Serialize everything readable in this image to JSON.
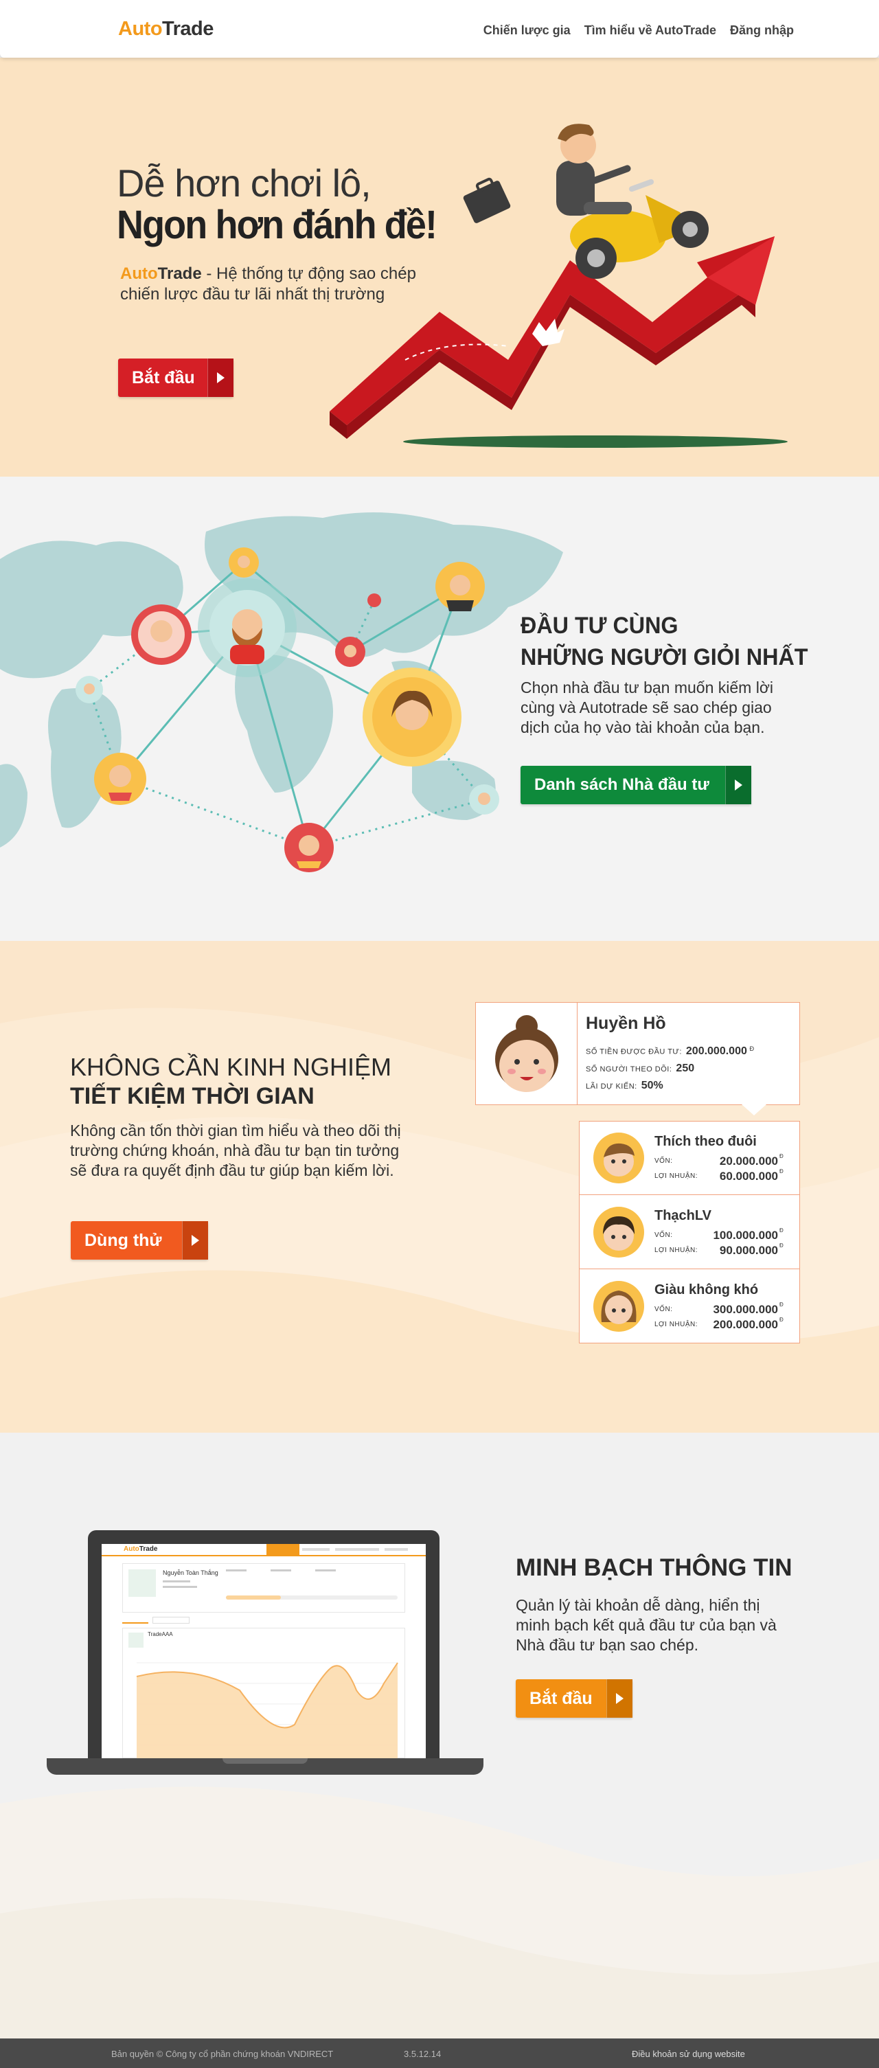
{
  "header": {
    "logo_auto": "Auto",
    "logo_trade": "Trade",
    "nav": [
      "Chiến lược gia",
      "Tìm hiểu về AutoTrade",
      "Đăng nhập"
    ]
  },
  "hero": {
    "title_line1": "Dễ hơn chơi lô,",
    "title_line2": "Ngon hơn đánh đề!",
    "sub_brand_auto": "Auto",
    "sub_brand_trade": "Trade",
    "sub_text": " - Hệ thống tự động sao chép chiến lược đầu tư lãi nhất thị trường",
    "button": "Bắt đầu"
  },
  "investors": {
    "title_line1": "ĐẦU TƯ CÙNG",
    "title_line2": "NHỮNG NGƯỜI GIỎI NHẤT",
    "text": "Chọn nhà đầu tư bạn muốn kiếm lời cùng và Autotrade sẽ sao chép giao dịch của họ vào tài khoản của bạn.",
    "button": "Danh sách Nhà đầu tư"
  },
  "experience": {
    "title_line1": "KHÔNG CẦN KINH NGHIỆM",
    "title_line2": "TIẾT KIỆM THỜI GIAN",
    "text": "Không cần tốn thời gian tìm hiểu và theo dõi thị trường chứng khoán, nhà đầu tư bạn tin tưởng sẽ đưa ra quyết định đầu tư giúp bạn kiếm lời.",
    "button": "Dùng thử",
    "leader": {
      "name": "Huyền Hồ",
      "invested_label": "Số tiền được đầu tư:",
      "invested_value": "200.000.000",
      "followers_label": "Số người theo dõi:",
      "followers_value": "250",
      "expected_label": "Lãi dự kiến:",
      "expected_value": "50%",
      "currency": "đ"
    },
    "followers": [
      {
        "name": "Thích theo đuôi",
        "capital_label": "Vốn:",
        "capital": "20.000.000",
        "profit_label": "Lợi nhuận:",
        "profit": "60.000.000"
      },
      {
        "name": "ThạchLV",
        "capital_label": "Vốn:",
        "capital": "100.000.000",
        "profit_label": "Lợi nhuận:",
        "profit": "90.000.000"
      },
      {
        "name": "Giàu không khó",
        "capital_label": "Vốn:",
        "capital": "300.000.000",
        "profit_label": "Lợi nhuận:",
        "profit": "200.000.000"
      }
    ]
  },
  "transparency": {
    "title": "MINH BẠCH THÔNG TIN",
    "text": "Quản lý tài khoản dễ dàng, hiển thị minh bạch kết quả đầu tư của bạn và Nhà đầu tư bạn sao chép.",
    "button": "Bắt đầu",
    "laptop": {
      "app_auto": "Auto",
      "app_trade": "Trade",
      "user": "Nguyễn Toàn Thắng",
      "account": "TradeAAA"
    }
  },
  "footer": {
    "copyright": "Bản quyền © Công ty cổ phần chứng khoán VNDIRECT",
    "version": "3.5.12.14",
    "terms": "Điều khoản sử dụng website"
  },
  "colors": {
    "brand_orange": "#f39a1c",
    "hero_bg": "#fbe3c2",
    "red": "#d51f26",
    "green": "#0e8a3b",
    "orange": "#f15a1f"
  }
}
